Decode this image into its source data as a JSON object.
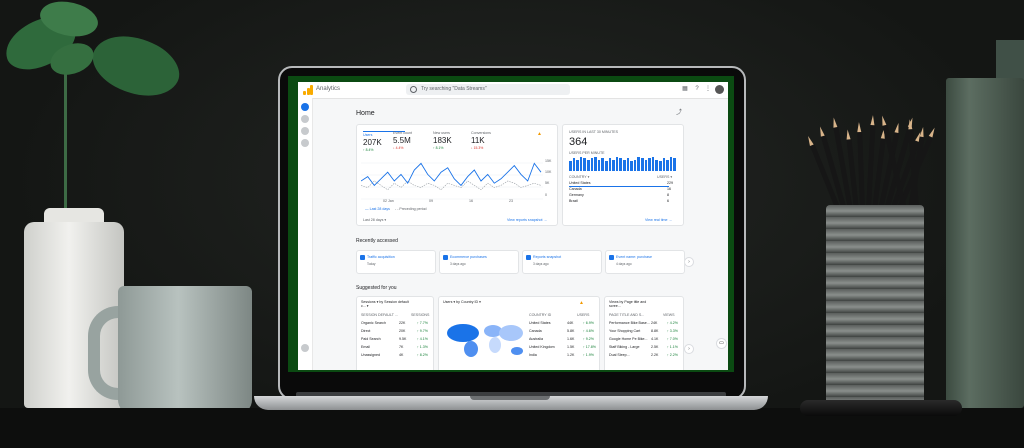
{
  "app": {
    "name": "Analytics",
    "search_placeholder": "Try searching \"Data Streams\""
  },
  "page": {
    "title": "Home"
  },
  "overview": {
    "metrics": [
      {
        "label": "Users",
        "value": "207K",
        "delta": "↑ 8.4%"
      },
      {
        "label": "Event count",
        "value": "5.5M",
        "delta": "↓ 4.4%"
      },
      {
        "label": "New users",
        "value": "183K",
        "delta": "↑ 8.1%"
      },
      {
        "label": "Conversions",
        "value": "11K",
        "delta": "↓ 15.3%"
      }
    ],
    "y_ticks": [
      "15K",
      "10K",
      "5K",
      "0"
    ],
    "x_ticks": [
      "02 Jan",
      "09",
      "16",
      "23",
      "30"
    ],
    "legend": [
      "— Last 28 days",
      "- - Preceding period"
    ],
    "date_range": "Last 28 days ▾",
    "link": "View reports snapshot →"
  },
  "realtime": {
    "heading": "USERS IN LAST 30 MINUTES",
    "value": "364",
    "sub": "USERS PER MINUTE",
    "col_country": "COUNTRY ▾",
    "col_users": "USERS ▾",
    "rows": [
      {
        "country": "United States",
        "users": "229"
      },
      {
        "country": "Canada",
        "users": "16"
      },
      {
        "country": "Germany",
        "users": "8"
      },
      {
        "country": "Brazil",
        "users": "6"
      }
    ],
    "link": "View real time →",
    "bars": [
      7,
      9,
      8,
      10,
      9,
      8,
      9,
      10,
      8,
      9,
      7,
      9,
      8,
      10,
      9,
      8,
      9,
      7,
      8,
      10,
      9,
      8,
      9,
      10,
      8,
      7,
      9,
      8,
      10,
      9
    ]
  },
  "recently_accessed": {
    "title": "Recently accessed",
    "items": [
      {
        "title": "Traffic acquisition",
        "sub": "Today"
      },
      {
        "title": "Ecommerce purchases",
        "sub": "3 days ago"
      },
      {
        "title": "Reports snapshot",
        "sub": "3 days ago"
      },
      {
        "title": "Event name: purchase",
        "sub": "4 days ago"
      }
    ]
  },
  "suggested": {
    "title": "Suggested for you",
    "card1": {
      "heading": "Sessions ▾ by Session default c... ▾",
      "col": "SESSION DEFAULT ...",
      "col2": "SESSIONS",
      "rows": [
        {
          "name": "Organic Search",
          "value": "22K",
          "delta": "↑ 7.7%"
        },
        {
          "name": "Direct",
          "value": "20K",
          "delta": "↑ 9.7%"
        },
        {
          "name": "Paid Search",
          "value": "9.5K",
          "delta": "↑ 4.1%"
        },
        {
          "name": "Email",
          "value": "7K",
          "delta": "↑ 1.3%"
        },
        {
          "name": "Unassigned",
          "value": "4K",
          "delta": "↑ 8.2%"
        }
      ]
    },
    "card2": {
      "heading": "Users ▾ by Country ID ▾",
      "col": "COUNTRY ID",
      "col2": "USERS",
      "rows": [
        {
          "name": "United States",
          "value": "44K",
          "delta": "↑ 6.9%"
        },
        {
          "name": "Canada",
          "value": "5.8K",
          "delta": "↑ 4.6%"
        },
        {
          "name": "Australia",
          "value": "1.6K",
          "delta": "↑ 9.2%"
        },
        {
          "name": "United Kingdom",
          "value": "1.5K",
          "delta": "↑ 17.8%"
        },
        {
          "name": "India",
          "value": "1.2K",
          "delta": "↑ 1.9%"
        }
      ]
    },
    "card3": {
      "heading": "Views by Page title and scree...",
      "col": "PAGE TITLE AND S...",
      "col2": "VIEWS",
      "rows": [
        {
          "name": "Performance Bike Base...",
          "value": "24K",
          "delta": "↑ 4.2%"
        },
        {
          "name": "Your Shopping Cart",
          "value": "8.8K",
          "delta": "↑ 3.3%"
        },
        {
          "name": "Google Home Pe Bike...",
          "value": "4.1K",
          "delta": "↑ 7.0%"
        },
        {
          "name": "Staff Biking - Large",
          "value": "2.5K",
          "delta": "↑ 1.1%"
        },
        {
          "name": "Dual Sleep...",
          "value": "2.2K",
          "delta": "↑ 2.2%"
        }
      ]
    }
  },
  "colors": {
    "accent": "#1a73e8",
    "up": "#188038",
    "down": "#d93025",
    "logo": "#f9ab00"
  }
}
